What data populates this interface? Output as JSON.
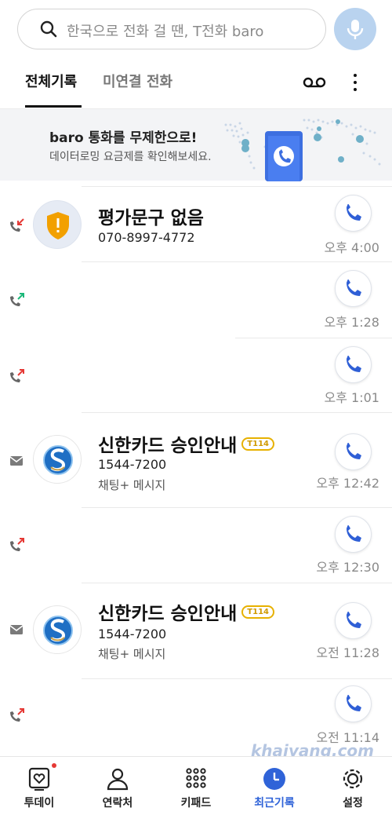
{
  "search": {
    "placeholder": "한국으로 전화 걸 땐, T전화 baro"
  },
  "tabs": [
    {
      "label": "전체기록"
    },
    {
      "label": "미연결 전화"
    }
  ],
  "banner": {
    "title": "baro 통화를 무제한으로!",
    "subtitle": "데이터로밍 요금제를 확인해보세요."
  },
  "calls": [
    {
      "direction": "incoming-missed",
      "name": "평가문구 없음",
      "number": "070-8997-4772",
      "time": "오후 4:00",
      "avatar": "warning-shield"
    },
    {
      "direction": "incoming",
      "time": "오후 1:28"
    },
    {
      "direction": "outgoing",
      "time": "오후 1:01"
    },
    {
      "direction": "message",
      "name": "신한카드 승인안내",
      "badge": "T114",
      "number": "1544-7200",
      "sub": "채팅+ 메시지",
      "time": "오후 12:42",
      "avatar": "shinhan-logo"
    },
    {
      "direction": "outgoing",
      "time": "오후 12:30"
    },
    {
      "direction": "message",
      "name": "신한카드 승인안내",
      "badge": "T114",
      "number": "1544-7200",
      "sub": "채팅+ 메시지",
      "time": "오전 11:28",
      "avatar": "shinhan-logo"
    },
    {
      "direction": "outgoing",
      "time": "오전 11:14"
    }
  ],
  "nav": [
    {
      "label": "투데이",
      "icon": "today-icon",
      "has_dot": true
    },
    {
      "label": "연락처",
      "icon": "contacts-icon"
    },
    {
      "label": "키패드",
      "icon": "keypad-icon"
    },
    {
      "label": "최근기록",
      "icon": "recent-icon",
      "active": true
    },
    {
      "label": "설정",
      "icon": "settings-icon"
    }
  ],
  "watermark": "khaiyang.com",
  "colors": {
    "accent": "#2f63d8",
    "call_icon": "#2f5fd6",
    "badge": "#e7b100",
    "missed": "#e53935",
    "incoming": "#1bb87a"
  }
}
